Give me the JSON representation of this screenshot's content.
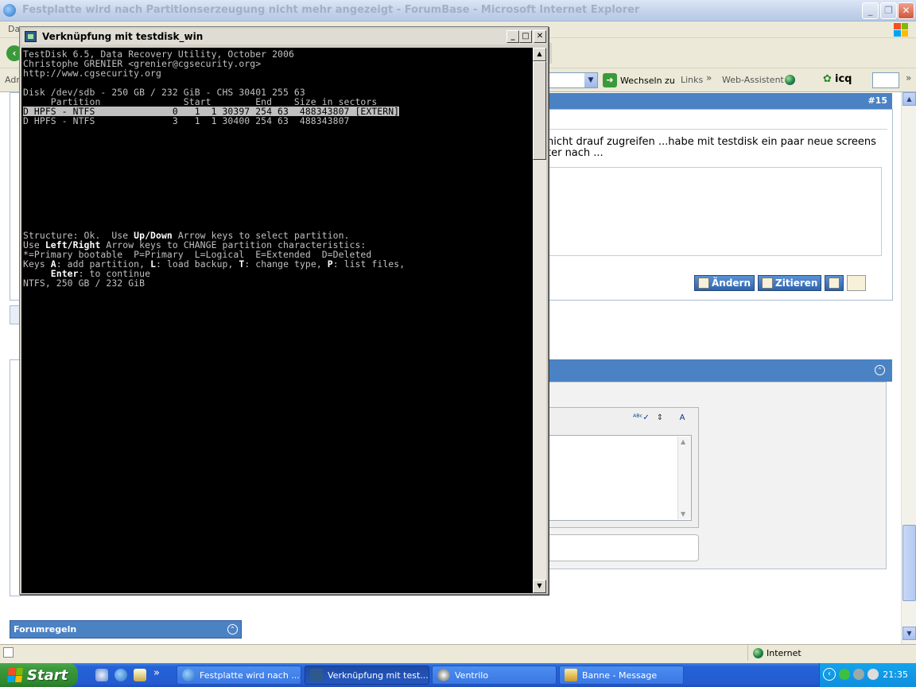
{
  "ie": {
    "title": "Festplatte wird nach Partitionserzeugung nicht mehr angezeigt - ForumBase - Microsoft Internet Explorer",
    "menu_fragment": "Da",
    "address_fragment": "Adr",
    "go_label": "Wechseln zu",
    "links_label": "Links",
    "web_assistant_label": "Web-Assistent",
    "icq_label": "icq",
    "status_zone": "Internet"
  },
  "post": {
    "number": "#15",
    "text_line1": "nicht drauf zugreifen ...habe mit testdisk ein paar neue screens",
    "text_line2": "ter nach ...",
    "edit_label": "Ändern",
    "quote_label": "Zitieren"
  },
  "forumregeln": "Forumregeln",
  "console": {
    "title": "Verknüpfung mit testdisk_win",
    "line01": "TestDisk 6.5, Data Recovery Utility, October 2006",
    "line02": "Christophe GRENIER <grenier@cgsecurity.org>",
    "line03": "http://www.cgsecurity.org",
    "line05": "Disk /dev/sdb - 250 GB / 232 GiB - CHS 30401 255 63",
    "line06": "     Partition               Start        End    Size in sectors",
    "line07": "D HPFS - NTFS              0   1  1 30397 254 63  488343807 [EXTERN]",
    "line08": "D HPFS - NTFS              3   1  1 30400 254 63  488343807",
    "s1_a": "Structure: Ok.  Use ",
    "s1_b": "Up/Down",
    "s1_c": " Arrow keys to select partition.",
    "s2_a": "Use ",
    "s2_b": "Left/Right",
    "s2_c": " Arrow keys to CHANGE partition characteristics:",
    "s3": "*=Primary bootable  P=Primary  L=Logical  E=Extended  D=Deleted",
    "s4_a": "Keys ",
    "s4_b": "A",
    "s4_c": ": add partition, ",
    "s4_d": "L",
    "s4_e": ": load backup, ",
    "s4_f": "T",
    "s4_g": ": change type, ",
    "s4_h": "P",
    "s4_i": ": list files,",
    "s5_a": "     ",
    "s5_b": "Enter",
    "s5_c": ": to continue",
    "s6": "NTFS, 250 GB / 232 GiB"
  },
  "taskbar": {
    "start_label": "Start",
    "tasks": [
      {
        "label": "Festplatte wird nach ..."
      },
      {
        "label": "Verknüpfung mit test..."
      },
      {
        "label": "Ventrilo"
      },
      {
        "label": "Banne - Message"
      }
    ],
    "clock": "21:35"
  },
  "colors": {
    "ie_header_blue": "#4b82c3",
    "console_bg": "#000000",
    "console_fg": "#c0c0c0",
    "taskbar_blue": "#245bd0",
    "start_green": "#3c9a3c"
  }
}
